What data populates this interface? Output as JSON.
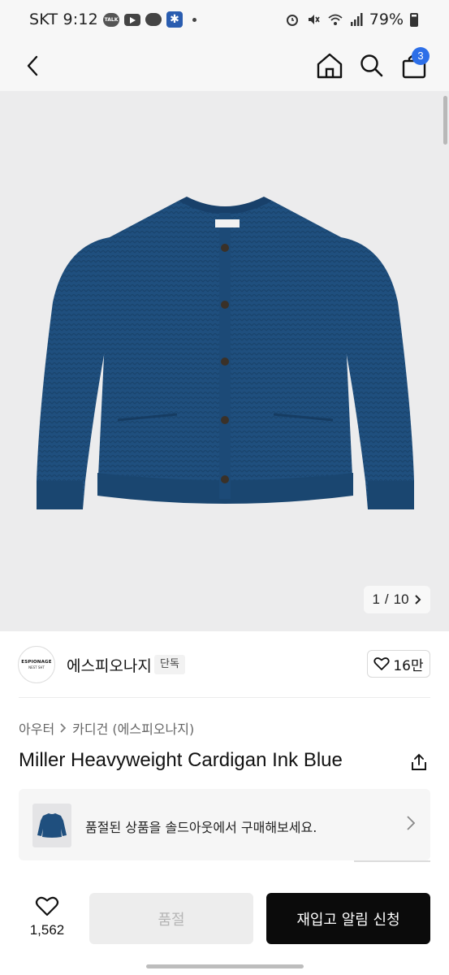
{
  "status_bar": {
    "carrier_time": "SKT 9:12",
    "talk_label": "TALK",
    "battery": "79%"
  },
  "header": {
    "cart_count": "3"
  },
  "gallery": {
    "page_current": "1",
    "page_separator": "/",
    "page_total": "10"
  },
  "brand": {
    "logo_text": "ESPIONAGE",
    "logo_sub": "NEST SHT",
    "name": "에스피오나지",
    "badge": "단독",
    "likes": "16만"
  },
  "breadcrumb": {
    "items": [
      "아우터",
      "카디건 (에스피오나지)"
    ]
  },
  "product": {
    "title": "Miller Heavyweight Cardigan Ink Blue"
  },
  "soldout_banner": {
    "text": "품절된 상품을 솔드아웃에서 구매해보세요."
  },
  "bottom_bar": {
    "wish_count": "1,562",
    "soldout_label": "품절",
    "restock_label": "재입고 알림 신청"
  },
  "colors": {
    "cart_badge": "#2d6fe8",
    "cardigan": "#1f4f7e",
    "primary_button": "#0b0b0b"
  }
}
